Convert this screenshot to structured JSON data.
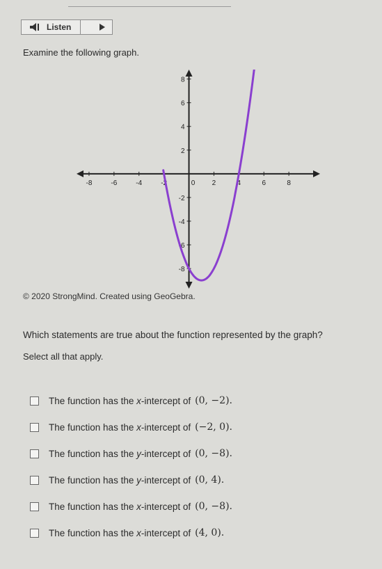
{
  "toolbar": {
    "listen_label": "Listen",
    "speaker_icon": "speaker-icon",
    "play_icon": "play-icon"
  },
  "prompt": "Examine the following graph.",
  "chart_data": {
    "type": "line",
    "x_ticks": [
      "-8",
      "-6",
      "-4",
      "-2",
      "0",
      "2",
      "4",
      "6",
      "8"
    ],
    "y_ticks": [
      "8",
      "6",
      "4",
      "2",
      "-2",
      "-4",
      "-6",
      "-8"
    ],
    "xlim": [
      -9,
      10.5
    ],
    "ylim": [
      -9.7,
      8.8
    ],
    "grid": false,
    "series": [
      {
        "function": "y = x^2 - 2x - 8",
        "x_range": [
          -2.05,
          5.95
        ],
        "color": "#8a3fcf"
      }
    ]
  },
  "credit": "© 2020 StrongMind. Created using GeoGebra.",
  "question": "Which statements are true about the function represented by the graph?",
  "instruction": "Select all that apply.",
  "options": [
    {
      "prefix": "The function has the",
      "var": "x",
      "suffix": "-intercept of",
      "point": "(0, −2)."
    },
    {
      "prefix": "The function has the",
      "var": "x",
      "suffix": "-intercept of",
      "point": "(−2, 0)."
    },
    {
      "prefix": "The function has the",
      "var": "y",
      "suffix": "-intercept of",
      "point": "(0, −8)."
    },
    {
      "prefix": "The function has the",
      "var": "y",
      "suffix": "-intercept of",
      "point": "(0, 4)."
    },
    {
      "prefix": "The function has the",
      "var": "x",
      "suffix": "-intercept of",
      "point": "(0, −8)."
    },
    {
      "prefix": "The function has the",
      "var": "x",
      "suffix": "-intercept of",
      "point": "(4, 0)."
    }
  ]
}
